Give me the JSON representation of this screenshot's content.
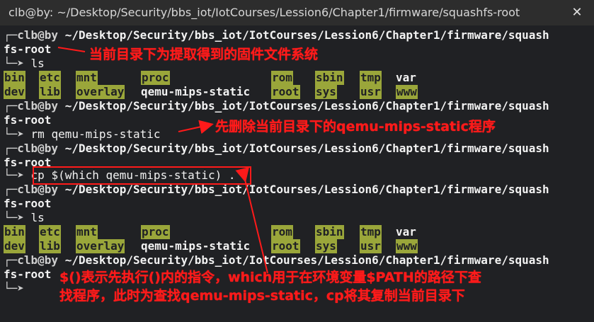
{
  "window": {
    "title": "clb@by: ~/Desktop/Security/bbs_iot/IotCourses/Lession6/Chapter1/firmware/squashfs-root",
    "close_symbol": "✕"
  },
  "terminal": {
    "prompt_user": "┌─clb@by",
    "path_line1": " ~/Desktop/Security/bbs_iot/IotCourses/Lession6/Chapter1/firmware/squash",
    "path_line2": "fs-root",
    "prompt_arrow": "└─➤",
    "cmd_ls": " ls",
    "cmd_rm": " rm qemu-mips-static",
    "cmd_cp": " cp $(which qemu-mips-static) .",
    "ls_row1": [
      "bin",
      "etc",
      "mnt",
      "proc",
      "rom",
      "sbin",
      "tmp",
      "var"
    ],
    "ls_row2": [
      "dev",
      "lib",
      "overlay",
      "qemu-mips-static",
      "root",
      "sys",
      "usr",
      "www"
    ]
  },
  "annotations": {
    "note1": "当前目录下为提取得到的固件文件系统",
    "note2": "先删除当前目录下的qemu-mips-static程序",
    "note3_line1": "$()表示先执行()内的指令，which用于在环境变量$PATH的路径下查",
    "note3_line2": "找程序，此时为查找qemu-mips-static，cp将其复制当前目录下",
    "color": "#ff1a1a"
  }
}
